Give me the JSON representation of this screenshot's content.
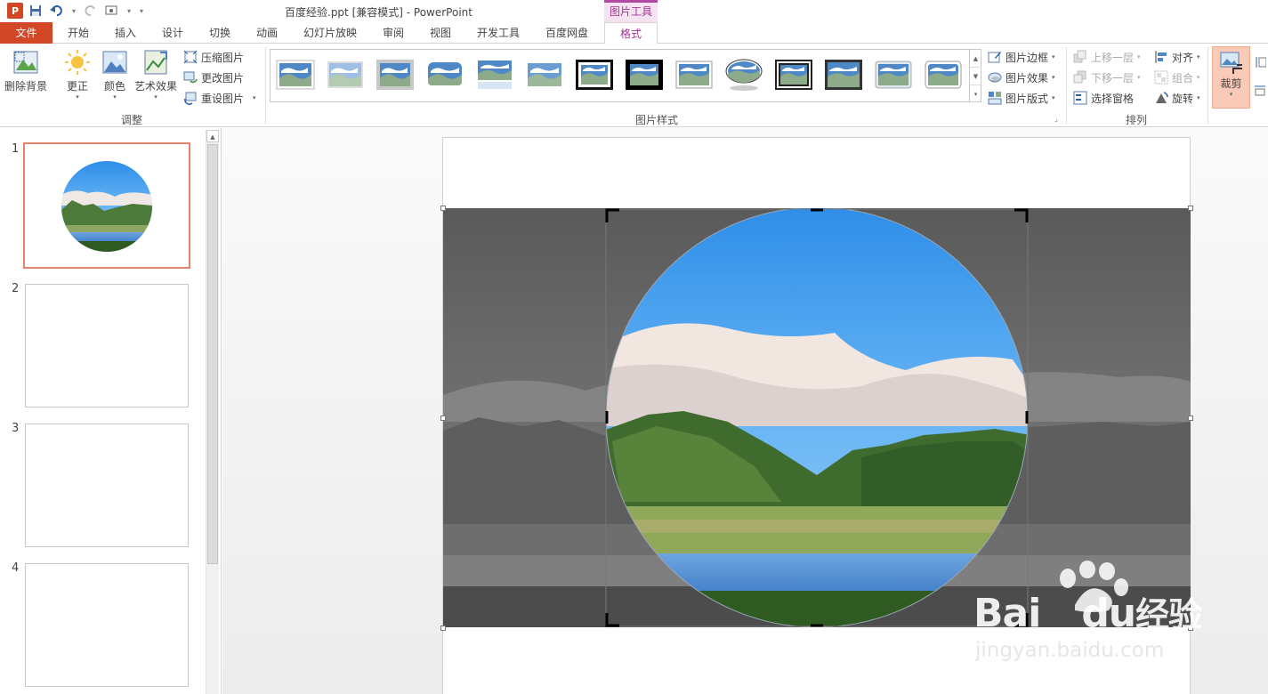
{
  "window": {
    "title": "百度经验.ppt [兼容模式] - PowerPoint",
    "context_tab_group": "图片工具"
  },
  "quick_access": {
    "app_icon_letter": "P",
    "icons": [
      "save-icon",
      "undo-icon",
      "redo-icon",
      "touch-mode-icon",
      "customize-icon"
    ]
  },
  "tabs": [
    {
      "label": "文件",
      "id": "file"
    },
    {
      "label": "开始",
      "id": "home"
    },
    {
      "label": "插入",
      "id": "insert"
    },
    {
      "label": "设计",
      "id": "design"
    },
    {
      "label": "切换",
      "id": "transitions"
    },
    {
      "label": "动画",
      "id": "animations"
    },
    {
      "label": "幻灯片放映",
      "id": "slideshow"
    },
    {
      "label": "审阅",
      "id": "review"
    },
    {
      "label": "视图",
      "id": "view"
    },
    {
      "label": "开发工具",
      "id": "developer"
    },
    {
      "label": "百度网盘",
      "id": "baidu-netdisk"
    },
    {
      "label": "格式",
      "id": "format",
      "active": true
    }
  ],
  "ribbon": {
    "adjust": {
      "remove_bg": "删除背景",
      "corrections": "更正",
      "color": "颜色",
      "artistic": "艺术效果",
      "compress": "压缩图片",
      "change": "更改图片",
      "reset": "重设图片",
      "group_label": "调整"
    },
    "styles": {
      "group_label": "图片样式",
      "border": "图片边框",
      "effects": "图片效果",
      "layout": "图片版式",
      "thumbnails": [
        "simple-frame-white",
        "soft-edge",
        "drop-shadow-gray",
        "rounded-soft",
        "reflected-rounded",
        "soft-edge-rect",
        "thick-black-frame",
        "black-frame-shadow",
        "simple-rect",
        "oval-reflected",
        "double-frame-black",
        "compound-frame",
        "beveled-oval",
        "relaxed-perspective"
      ]
    },
    "arrange": {
      "bring_forward": "上移一层",
      "send_backward": "下移一层",
      "selection_pane": "选择窗格",
      "align": "对齐",
      "group": "组合",
      "rotate": "旋转",
      "group_label": "排列"
    },
    "size": {
      "crop": "裁剪"
    }
  },
  "slides": {
    "numbers": [
      "1",
      "2",
      "3",
      "4"
    ],
    "selected": "1"
  },
  "watermark": {
    "brand": "Bai",
    "brand2": "du",
    "brand_cn": "经验",
    "url": "jingyan.baidu.com"
  },
  "colors": {
    "accent_file_tab": "#d24726",
    "context_tab": "#a3368f",
    "crop_active": "#f8cab7",
    "selected_slide_border": "#e0846a"
  }
}
